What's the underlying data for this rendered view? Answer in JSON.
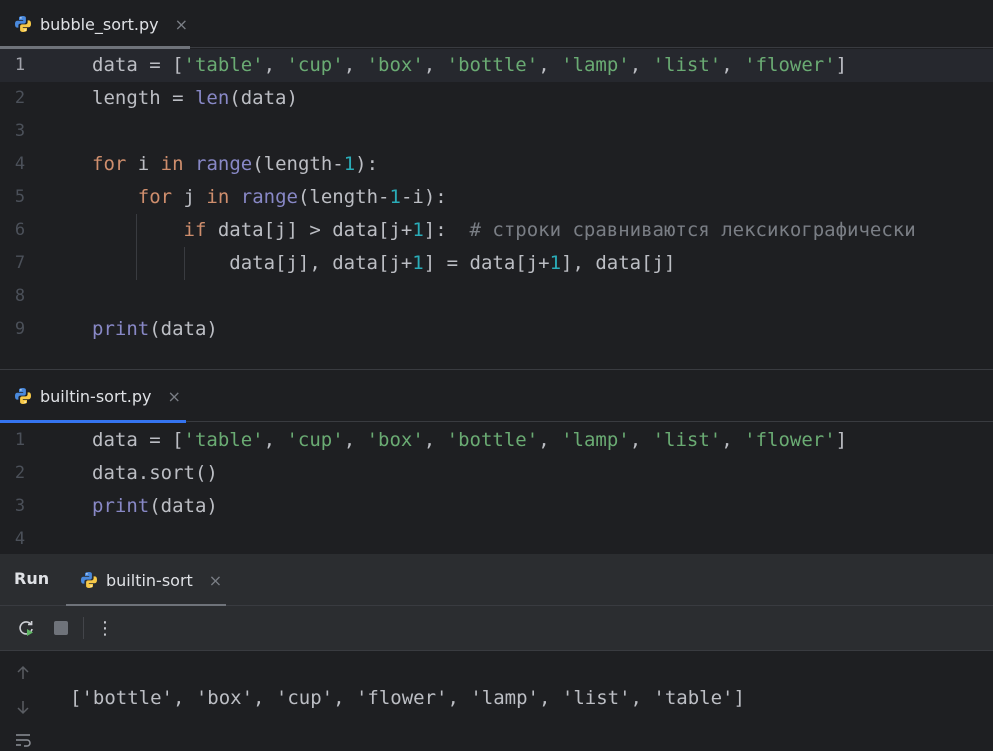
{
  "tabs": {
    "top": {
      "label": "bubble_sort.py",
      "close": "×"
    },
    "bottom": {
      "label": "builtin-sort.py",
      "close": "×"
    }
  },
  "colors": {
    "accent": "#3574f0",
    "keyword": "#cf8e6d",
    "string": "#6aab73",
    "number": "#2aacb8",
    "builtin": "#8888c6",
    "comment": "#7a7e85"
  },
  "editor1": {
    "lines": [
      {
        "num": "1",
        "current": true,
        "guides": [],
        "tokens": [
          [
            "plain",
            "data = ["
          ],
          [
            "str",
            "'table'"
          ],
          [
            "plain",
            ", "
          ],
          [
            "str",
            "'cup'"
          ],
          [
            "plain",
            ", "
          ],
          [
            "str",
            "'box'"
          ],
          [
            "plain",
            ", "
          ],
          [
            "str",
            "'bottle'"
          ],
          [
            "plain",
            ", "
          ],
          [
            "str",
            "'lamp'"
          ],
          [
            "plain",
            ", "
          ],
          [
            "str",
            "'list'"
          ],
          [
            "plain",
            ", "
          ],
          [
            "str",
            "'flower'"
          ],
          [
            "plain",
            "]"
          ]
        ]
      },
      {
        "num": "2",
        "guides": [],
        "tokens": [
          [
            "plain",
            "length = "
          ],
          [
            "fn",
            "len"
          ],
          [
            "plain",
            "(data)"
          ]
        ]
      },
      {
        "num": "3",
        "guides": [],
        "tokens": []
      },
      {
        "num": "4",
        "guides": [],
        "tokens": [
          [
            "kw",
            "for"
          ],
          [
            "plain",
            " i "
          ],
          [
            "kw",
            "in"
          ],
          [
            "plain",
            " "
          ],
          [
            "fn",
            "range"
          ],
          [
            "plain",
            "(length-"
          ],
          [
            "num",
            "1"
          ],
          [
            "plain",
            "):"
          ]
        ]
      },
      {
        "num": "5",
        "guides": [],
        "tokens": [
          [
            "plain",
            "    "
          ],
          [
            "kw",
            "for"
          ],
          [
            "plain",
            " j "
          ],
          [
            "kw",
            "in"
          ],
          [
            "plain",
            " "
          ],
          [
            "fn",
            "range"
          ],
          [
            "plain",
            "(length-"
          ],
          [
            "num",
            "1"
          ],
          [
            "plain",
            "-i):"
          ]
        ]
      },
      {
        "num": "6",
        "guides": [
          1
        ],
        "tokens": [
          [
            "plain",
            "        "
          ],
          [
            "kw",
            "if"
          ],
          [
            "plain",
            " data[j] > data[j+"
          ],
          [
            "num",
            "1"
          ],
          [
            "plain",
            "]:  "
          ],
          [
            "cm",
            "# строки сравниваются лексикографически"
          ]
        ]
      },
      {
        "num": "7",
        "guides": [
          1,
          2
        ],
        "tokens": [
          [
            "plain",
            "            data[j], data[j+"
          ],
          [
            "num",
            "1"
          ],
          [
            "plain",
            "] = data[j+"
          ],
          [
            "num",
            "1"
          ],
          [
            "plain",
            "], data[j]"
          ]
        ]
      },
      {
        "num": "8",
        "guides": [],
        "tokens": []
      },
      {
        "num": "9",
        "guides": [],
        "tokens": [
          [
            "fn",
            "print"
          ],
          [
            "plain",
            "(data)"
          ]
        ]
      }
    ]
  },
  "editor2": {
    "lines": [
      {
        "num": "1",
        "guides": [],
        "tokens": [
          [
            "plain",
            "data = ["
          ],
          [
            "str",
            "'table'"
          ],
          [
            "plain",
            ", "
          ],
          [
            "str",
            "'cup'"
          ],
          [
            "plain",
            ", "
          ],
          [
            "str",
            "'box'"
          ],
          [
            "plain",
            ", "
          ],
          [
            "str",
            "'bottle'"
          ],
          [
            "plain",
            ", "
          ],
          [
            "str",
            "'lamp'"
          ],
          [
            "plain",
            ", "
          ],
          [
            "str",
            "'list'"
          ],
          [
            "plain",
            ", "
          ],
          [
            "str",
            "'flower'"
          ],
          [
            "plain",
            "]"
          ]
        ]
      },
      {
        "num": "2",
        "guides": [],
        "tokens": [
          [
            "plain",
            "data.sort()"
          ]
        ]
      },
      {
        "num": "3",
        "guides": [],
        "tokens": [
          [
            "fn",
            "print"
          ],
          [
            "plain",
            "(data)"
          ]
        ]
      },
      {
        "num": "4",
        "guides": [],
        "tokens": []
      }
    ]
  },
  "run": {
    "title": "Run",
    "tab_label": "builtin-sort",
    "tab_close": "×",
    "menu_glyph": "⋮",
    "output": "['bottle', 'box', 'cup', 'flower', 'lamp', 'list', 'table']"
  }
}
